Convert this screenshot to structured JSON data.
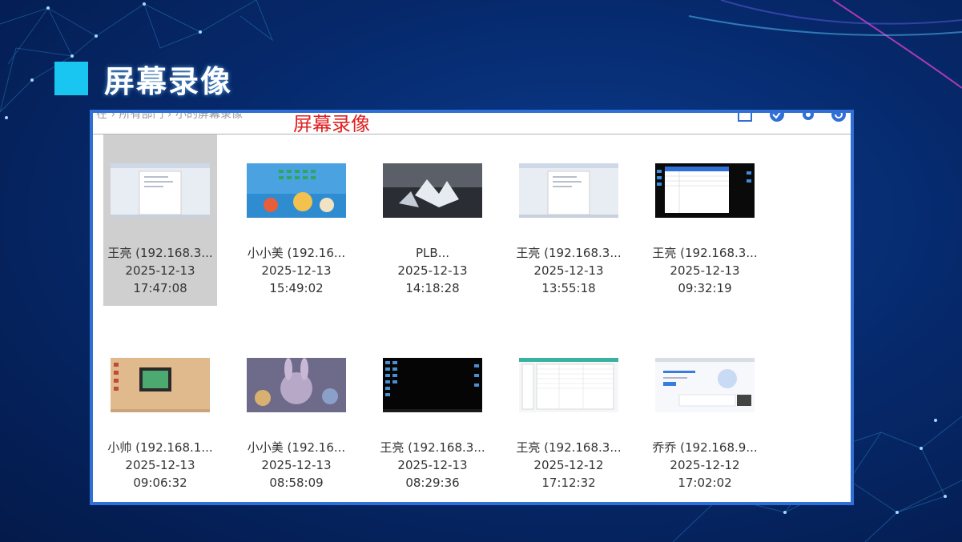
{
  "slide": {
    "title": "屏幕录像",
    "accent_color": "#19c6f2"
  },
  "window": {
    "breadcrumb": "在 › 所有部门 › 小的屏幕录像",
    "overlay_title": "屏幕录像",
    "toolbar_icons": [
      "square-icon",
      "check-circle-icon",
      "gear-icon",
      "refresh-icon"
    ]
  },
  "recordings": [
    {
      "name": "王亮 (192.168.3...",
      "date": "2025-12-13",
      "time": "17:47:08",
      "selected": true,
      "thumbnail": "document-window"
    },
    {
      "name": "小小美 (192.16...",
      "date": "2025-12-13",
      "time": "15:49:02",
      "selected": false,
      "thumbnail": "cartoon-desktop"
    },
    {
      "name": "PLB...",
      "date": "2025-12-13",
      "time": "14:18:28",
      "selected": false,
      "thumbnail": "ice-crystal"
    },
    {
      "name": "王亮 (192.168.3...",
      "date": "2025-12-13",
      "time": "13:55:18",
      "selected": false,
      "thumbnail": "document-window"
    },
    {
      "name": "王亮 (192.168.3...",
      "date": "2025-12-13",
      "time": "09:32:19",
      "selected": false,
      "thumbnail": "spreadsheet-dark-desktop"
    },
    {
      "name": "小帅 (192.168.1...",
      "date": "2025-12-13",
      "time": "09:06:32",
      "selected": false,
      "thumbnail": "tan-desktop"
    },
    {
      "name": "小小美 (192.16...",
      "date": "2025-12-13",
      "time": "08:58:09",
      "selected": false,
      "thumbnail": "animated-rabbit"
    },
    {
      "name": "王亮 (192.168.3...",
      "date": "2025-12-13",
      "time": "08:29:36",
      "selected": false,
      "thumbnail": "black-desktop"
    },
    {
      "name": "王亮 (192.168.3...",
      "date": "2025-12-12",
      "time": "17:12:32",
      "selected": false,
      "thumbnail": "spreadsheet-window"
    },
    {
      "name": "乔乔 (192.168.9...",
      "date": "2025-12-12",
      "time": "17:02:02",
      "selected": false,
      "thumbnail": "web-page"
    }
  ]
}
